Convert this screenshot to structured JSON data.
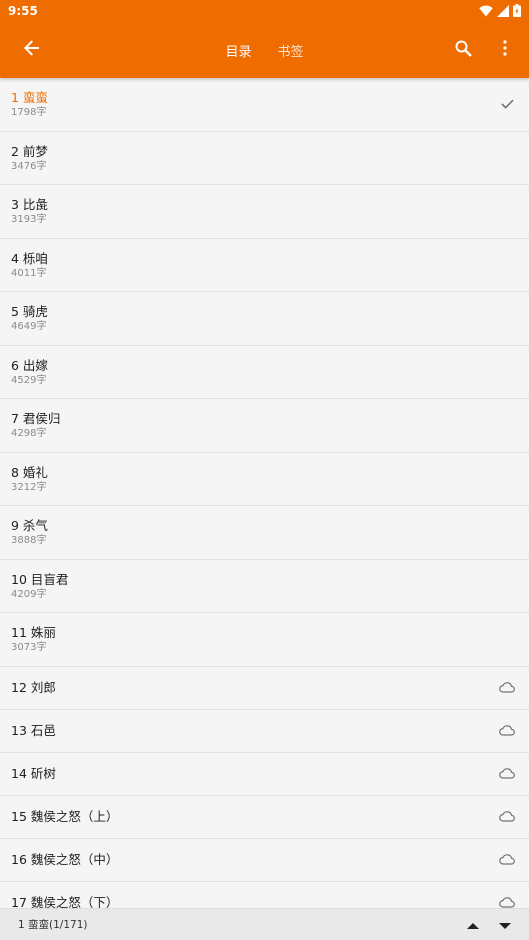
{
  "status_bar": {
    "time": "9:55"
  },
  "toolbar": {
    "tabs": [
      {
        "label": "目录",
        "active": true
      },
      {
        "label": "书签",
        "active": false
      }
    ]
  },
  "colors": {
    "accent": "#ef6c00",
    "background": "#f5f5f5",
    "divider": "#e3e3e3"
  },
  "chapters": [
    {
      "title": "1 蛮蛮",
      "words": "1798字",
      "state": "current",
      "icon": "check-icon"
    },
    {
      "title": "2 前梦",
      "words": "3476字",
      "state": "cached"
    },
    {
      "title": "3 比彘",
      "words": "3193字",
      "state": "cached"
    },
    {
      "title": "4 栎咱",
      "words": "4011字",
      "state": "cached"
    },
    {
      "title": "5 骑虎",
      "words": "4649字",
      "state": "cached"
    },
    {
      "title": "6 出嫁",
      "words": "4529字",
      "state": "cached"
    },
    {
      "title": "7 君侯归",
      "words": "4298字",
      "state": "cached"
    },
    {
      "title": "8 婚礼",
      "words": "3212字",
      "state": "cached"
    },
    {
      "title": "9 杀气",
      "words": "3888字",
      "state": "cached"
    },
    {
      "title": "10 目盲君",
      "words": "4209字",
      "state": "cached"
    },
    {
      "title": "11 姝丽",
      "words": "3073字",
      "state": "cached"
    },
    {
      "title": "12 刘郎",
      "state": "cloud",
      "icon": "cloud-icon"
    },
    {
      "title": "13 石邑",
      "state": "cloud",
      "icon": "cloud-icon"
    },
    {
      "title": "14 斫树",
      "state": "cloud",
      "icon": "cloud-icon"
    },
    {
      "title": "15 魏侯之怒（上）",
      "state": "cloud",
      "icon": "cloud-icon"
    },
    {
      "title": "16 魏侯之怒（中）",
      "state": "cloud",
      "icon": "cloud-icon"
    },
    {
      "title": "17 魏侯之怒（下）",
      "state": "cloud",
      "icon": "cloud-icon"
    }
  ],
  "bottom_bar": {
    "position_text": "1 蛮蛮(1/171)"
  }
}
